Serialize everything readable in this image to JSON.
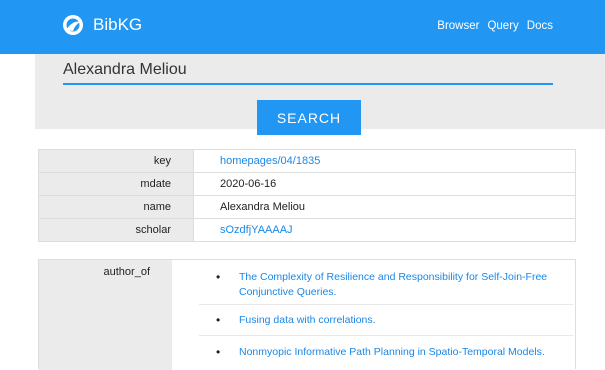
{
  "header": {
    "brand": "BibKG",
    "nav": [
      "Browser",
      "Query",
      "Docs"
    ]
  },
  "search": {
    "value": "Alexandra Meliou",
    "button_label": "SEARCH"
  },
  "record": {
    "rows": [
      {
        "key": "key",
        "value": "homepages/04/1835"
      },
      {
        "key": "mdate",
        "value": "2020-06-16"
      },
      {
        "key": "name",
        "value": "Alexandra Meliou"
      },
      {
        "key": "scholar",
        "value": "sOzdfjYAAAAJ"
      }
    ]
  },
  "author_of": {
    "label": "author_of",
    "bullet": "•",
    "items": [
      {
        "title": "The Complexity of Resilience and Responsibility for Self-Join-Free Conjunctive Queries."
      },
      {
        "title": "Fusing data with correlations."
      },
      {
        "title": "Nonmyopic Informative Path Planning in Spatio-Temporal Models."
      }
    ]
  },
  "icons": {
    "logo": "bibkg-logo-icon"
  },
  "colors": {
    "primary": "#2196f3",
    "link": "#1a88e6",
    "panel": "#ebebeb"
  }
}
